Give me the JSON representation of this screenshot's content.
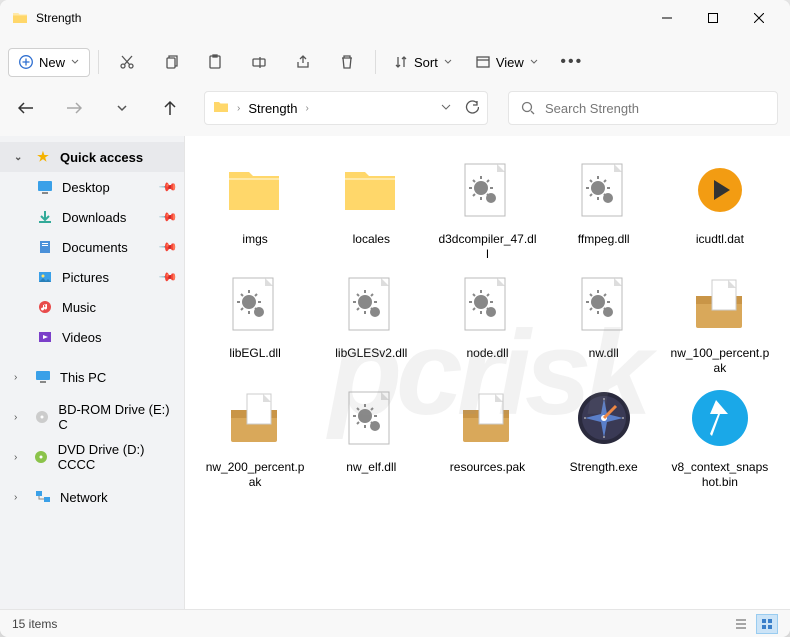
{
  "window": {
    "title": "Strength"
  },
  "toolbar": {
    "new_label": "New",
    "sort_label": "Sort",
    "view_label": "View"
  },
  "breadcrumb": {
    "item0": "Strength"
  },
  "search": {
    "placeholder": "Search Strength"
  },
  "sidebar": {
    "quick_access": "Quick access",
    "desktop": "Desktop",
    "downloads": "Downloads",
    "documents": "Documents",
    "pictures": "Pictures",
    "music": "Music",
    "videos": "Videos",
    "this_pc": "This PC",
    "bdrom": "BD-ROM Drive (E:) C",
    "dvd": "DVD Drive (D:) CCCC",
    "network": "Network"
  },
  "files": [
    {
      "name": "imgs",
      "type": "folder"
    },
    {
      "name": "locales",
      "type": "folder"
    },
    {
      "name": "d3dcompiler_47.dll",
      "type": "dll"
    },
    {
      "name": "ffmpeg.dll",
      "type": "dll"
    },
    {
      "name": "icudtl.dat",
      "type": "dat"
    },
    {
      "name": "libEGL.dll",
      "type": "dll"
    },
    {
      "name": "libGLESv2.dll",
      "type": "dll"
    },
    {
      "name": "node.dll",
      "type": "dll"
    },
    {
      "name": "nw.dll",
      "type": "dll"
    },
    {
      "name": "nw_100_percent.pak",
      "type": "pak"
    },
    {
      "name": "nw_200_percent.pak",
      "type": "pak"
    },
    {
      "name": "nw_elf.dll",
      "type": "dll"
    },
    {
      "name": "resources.pak",
      "type": "pak"
    },
    {
      "name": "Strength.exe",
      "type": "exe"
    },
    {
      "name": "v8_context_snapshot.bin",
      "type": "bin"
    }
  ],
  "status": {
    "count": "15 items"
  }
}
